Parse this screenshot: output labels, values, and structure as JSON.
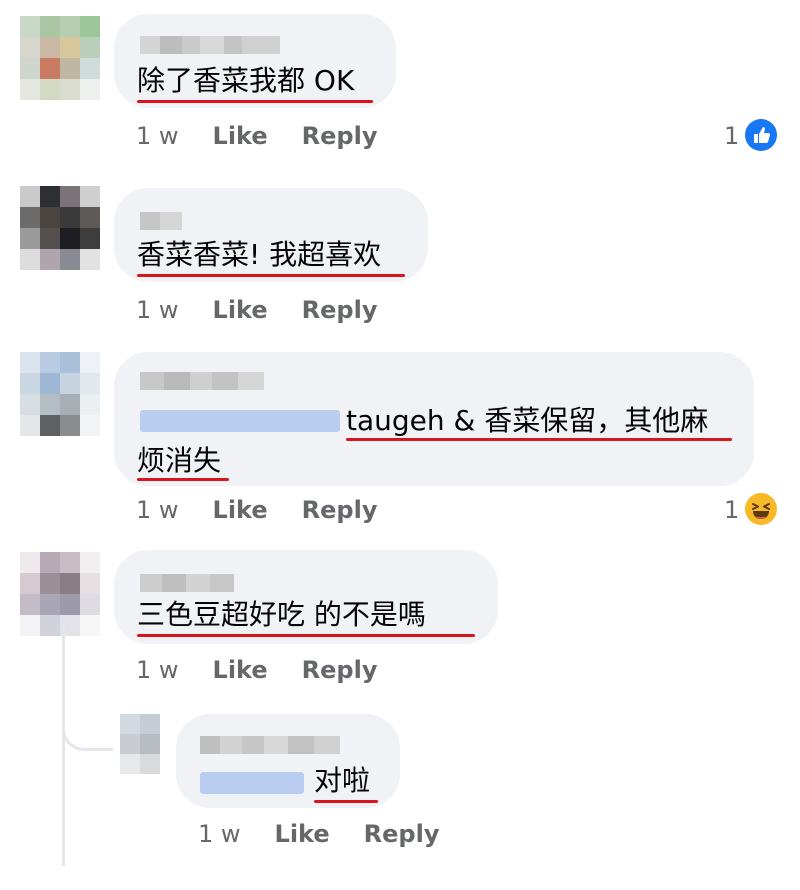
{
  "comments": [
    {
      "text": "除了香菜我都 OK",
      "time": "1 w",
      "like_label": "Like",
      "reply_label": "Reply",
      "reaction": {
        "count": "1",
        "icon": "like-icon"
      }
    },
    {
      "text": "香菜香菜! 我超喜欢",
      "time": "1 w",
      "like_label": "Like",
      "reply_label": "Reply"
    },
    {
      "text_line1": "taugeh & 香菜保留，其他麻",
      "text_line2": "烦消失",
      "time": "1 w",
      "like_label": "Like",
      "reply_label": "Reply",
      "reaction": {
        "count": "1",
        "icon": "haha-icon"
      }
    },
    {
      "text": "三色豆超好吃   的不是嗎",
      "time": "1 w",
      "like_label": "Like",
      "reply_label": "Reply"
    },
    {
      "text": "对啦",
      "time": "1 w",
      "like_label": "Like",
      "reply_label": "Reply"
    }
  ],
  "colors": {
    "bubble": "#f0f2f5",
    "underline": "#d8151c",
    "meta": "#65676b",
    "like_blue": "#1877f2",
    "haha_yellow": "#f7b928"
  }
}
